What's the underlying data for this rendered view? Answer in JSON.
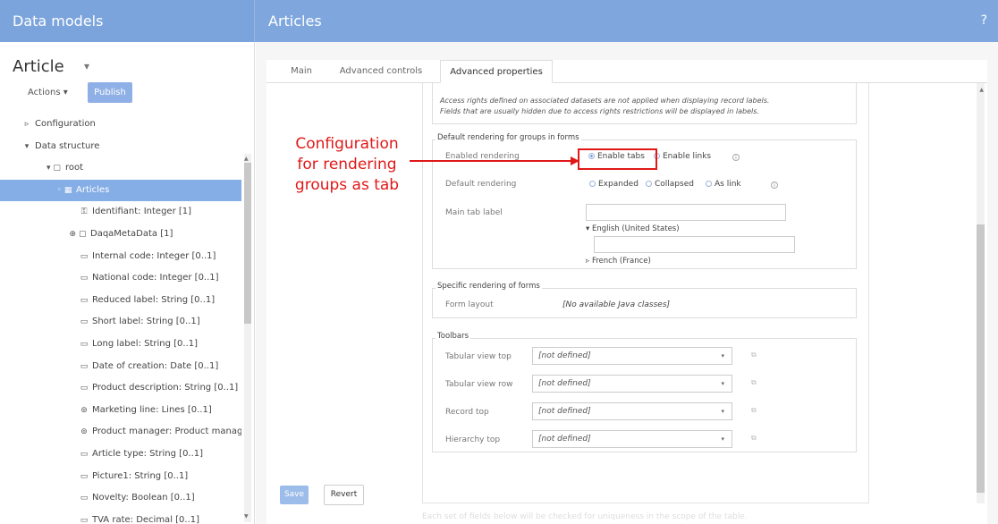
{
  "header": {
    "left_title": "Data models",
    "right_title": "Articles",
    "help": "?"
  },
  "sidebar": {
    "title": "Article",
    "title_caret": "▾",
    "actions_label": "Actions ▾",
    "publish_label": "Publish",
    "tree": [
      {
        "glyph": "▹",
        "label": "Configuration"
      },
      {
        "glyph": "▾",
        "label": "Data structure"
      },
      {
        "glyph": "▾ ▢",
        "label": "root"
      },
      {
        "glyph": "◦ ▦",
        "label": "Articles"
      },
      {
        "glyph": "⚿",
        "label": "Identifiant: Integer  [1]"
      },
      {
        "glyph": "⊕ ▢",
        "label": "DaqaMetaData [1]"
      },
      {
        "glyph": "▭",
        "label": "Internal code: Integer  [0..1]"
      },
      {
        "glyph": "▭",
        "label": "National code: Integer  [0..1]"
      },
      {
        "glyph": "▭",
        "label": "Reduced label: String  [0..1]"
      },
      {
        "glyph": "▭",
        "label": "Short label: String  [0..1]"
      },
      {
        "glyph": "▭",
        "label": "Long label: String  [0..1]"
      },
      {
        "glyph": "▭",
        "label": "Date of creation: Date  [0..1]"
      },
      {
        "glyph": "▭",
        "label": "Product description: String  [0..1]"
      },
      {
        "glyph": "⊚",
        "label": "Marketing line: Lines  [0..1]"
      },
      {
        "glyph": "⊚",
        "label": "Product manager: Product managers"
      },
      {
        "glyph": "▭",
        "label": "Article type: String  [0..1]"
      },
      {
        "glyph": "▭",
        "label": "Picture1: String  [0..1]"
      },
      {
        "glyph": "▭",
        "label": "Novelty: Boolean  [0..1]"
      },
      {
        "glyph": "▭",
        "label": "TVA rate: Decimal  [0..1]"
      }
    ]
  },
  "tabs": [
    {
      "label": "Main"
    },
    {
      "label": "Advanced controls"
    },
    {
      "label": "Advanced properties"
    }
  ],
  "notes": {
    "line1": "Access rights defined on associated datasets are not applied when displaying record labels.",
    "line2": "Fields that are usually hidden due to access rights restrictions will be displayed in labels."
  },
  "groups_rendering": {
    "legend": "Default rendering for groups in forms",
    "enabled_rendering_label": "Enabled rendering",
    "enable_tabs": "Enable tabs",
    "enable_links": "Enable links",
    "default_rendering_label": "Default rendering",
    "expanded": "Expanded",
    "collapsed": "Collapsed",
    "as_link": "As link",
    "main_tab_label": "Main tab label",
    "english": "English (United States)",
    "french": "French (France)"
  },
  "specific_rendering": {
    "legend": "Specific rendering of forms",
    "form_layout_label": "Form layout",
    "form_layout_value": "[No available Java classes]"
  },
  "toolbars": {
    "legend": "Toolbars",
    "rows": [
      {
        "label": "Tabular view top",
        "value": "[not defined]"
      },
      {
        "label": "Tabular view row",
        "value": "[not defined]"
      },
      {
        "label": "Record top",
        "value": "[not defined]"
      },
      {
        "label": "Hierarchy top",
        "value": "[not defined]"
      }
    ]
  },
  "faded": {
    "bottom_text": "Each set of fields below will be checked for uniqueness in the scope of the table."
  },
  "annotation": {
    "text": "Configuration for rendering groups as tab"
  },
  "buttons": {
    "save": "Save",
    "revert": "Revert"
  },
  "colors": {
    "header": "#7fa7de",
    "selection": "#85aee6",
    "annotation": "#e01818"
  }
}
